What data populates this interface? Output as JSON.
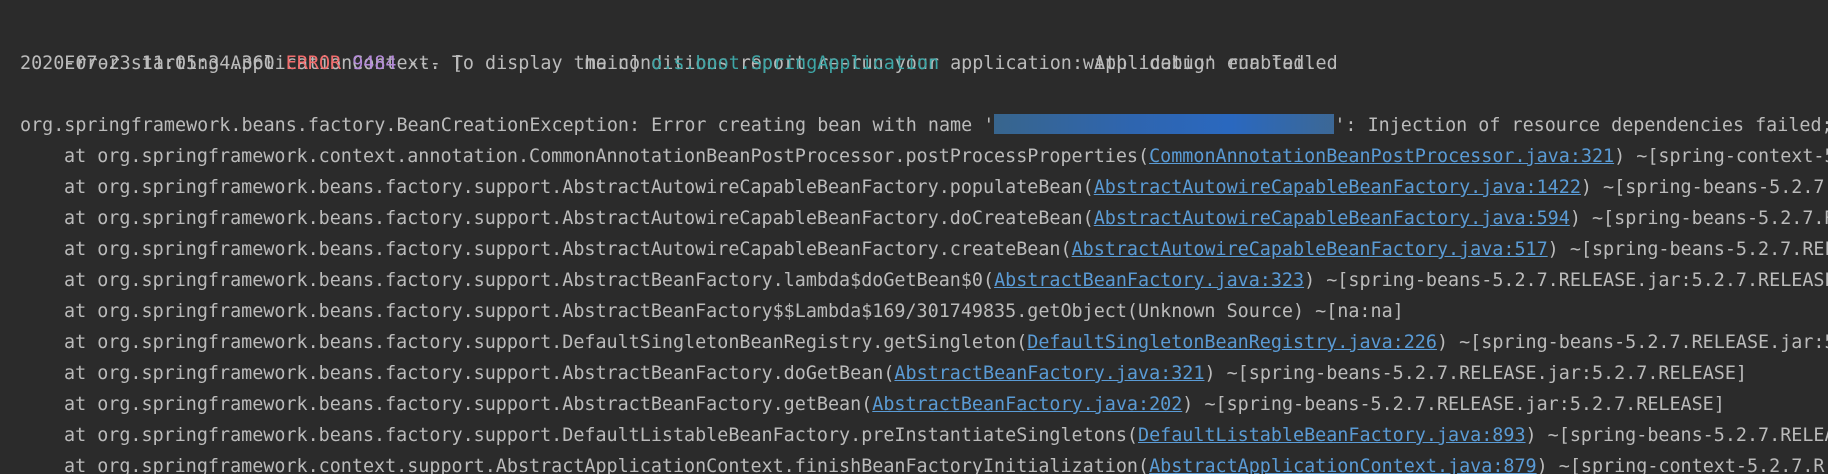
{
  "console": {
    "header_line": "Error starting ApplicationContext. To display the conditions report re-run your application with 'debug' enabled.",
    "log_entry": {
      "timestamp": "2020-07-23 11:05:34.360",
      "level": "ERROR",
      "pid": "9484",
      "separator": "--- [",
      "thread": "           main]",
      "logger": "o.s.boot.SpringApplication",
      "message": ": Application run failed"
    },
    "exception": {
      "prefix": "org.springframework.beans.factory.BeanCreationException: Error creating bean with name '",
      "suffix": "': Injection of resource dependencies failed;"
    },
    "stack": [
      {
        "method": "at org.springframework.context.annotation.CommonAnnotationBeanPostProcessor.postProcessProperties(",
        "source": "CommonAnnotationBeanPostProcessor.java:321",
        "tail": ") ~[spring-context-5"
      },
      {
        "method": "at org.springframework.beans.factory.support.AbstractAutowireCapableBeanFactory.populateBean(",
        "source": "AbstractAutowireCapableBeanFactory.java:1422",
        "tail": ") ~[spring-beans-5.2.7."
      },
      {
        "method": "at org.springframework.beans.factory.support.AbstractAutowireCapableBeanFactory.doCreateBean(",
        "source": "AbstractAutowireCapableBeanFactory.java:594",
        "tail": ") ~[spring-beans-5.2.7.R"
      },
      {
        "method": "at org.springframework.beans.factory.support.AbstractAutowireCapableBeanFactory.createBean(",
        "source": "AbstractAutowireCapableBeanFactory.java:517",
        "tail": ") ~[spring-beans-5.2.7.REL"
      },
      {
        "method": "at org.springframework.beans.factory.support.AbstractBeanFactory.lambda$doGetBean$0(",
        "source": "AbstractBeanFactory.java:323",
        "tail": ") ~[spring-beans-5.2.7.RELEASE.jar:5.2.7.RELEASE"
      },
      {
        "method": "at org.springframework.beans.factory.support.AbstractBeanFactory$$Lambda$169/301749835.getObject(Unknown Source) ~[na:na]",
        "source": "",
        "tail": ""
      },
      {
        "method": "at org.springframework.beans.factory.support.DefaultSingletonBeanRegistry.getSingleton(",
        "source": "DefaultSingletonBeanRegistry.java:226",
        "tail": ") ~[spring-beans-5.2.7.RELEASE.jar:5"
      },
      {
        "method": "at org.springframework.beans.factory.support.AbstractBeanFactory.doGetBean(",
        "source": "AbstractBeanFactory.java:321",
        "tail": ") ~[spring-beans-5.2.7.RELEASE.jar:5.2.7.RELEASE]"
      },
      {
        "method": "at org.springframework.beans.factory.support.AbstractBeanFactory.getBean(",
        "source": "AbstractBeanFactory.java:202",
        "tail": ") ~[spring-beans-5.2.7.RELEASE.jar:5.2.7.RELEASE]"
      },
      {
        "method": "at org.springframework.beans.factory.support.DefaultListableBeanFactory.preInstantiateSingletons(",
        "source": "DefaultListableBeanFactory.java:893",
        "tail": ") ~[spring-beans-5.2.7.RELEA"
      },
      {
        "method": "at org.springframework.context.support.AbstractApplicationContext.finishBeanFactoryInitialization(",
        "source": "AbstractApplicationContext.java:879",
        "tail": ") ~[spring-context-5.2.7.R"
      }
    ]
  }
}
